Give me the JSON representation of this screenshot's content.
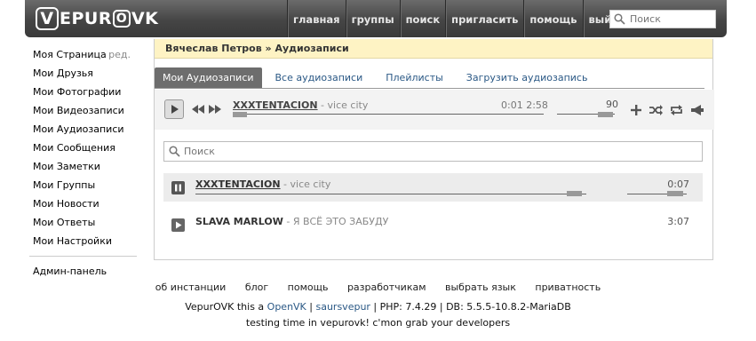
{
  "header": {
    "logo_text": "VEPUROVK",
    "logo_v": "V",
    "logo_epur": "EPUR",
    "logo_o": "O",
    "logo_vk": "VK",
    "nav": [
      "главная",
      "группы",
      "поиск",
      "пригласить",
      "помощь",
      "выйти"
    ],
    "search_placeholder": "Поиск"
  },
  "sidebar": {
    "items": [
      "Моя Страница",
      "Мои Друзья",
      "Мои Фотографии",
      "Мои Видеозаписи",
      "Мои Аудиозаписи",
      "Мои Сообщения",
      "Мои Заметки",
      "Мои Группы",
      "Мои Новости",
      "Мои Ответы",
      "Мои Настройки"
    ],
    "edit_label": "ред.",
    "admin": "Админ-панель"
  },
  "breadcrumb": {
    "user": "Вячеслав Петров",
    "sep": "»",
    "section": "Аудиозаписи"
  },
  "tabs": [
    "Мои Аудиозаписи",
    "Все аудиозаписи",
    "Плейлисты",
    "Загрузить аудиозапись"
  ],
  "player": {
    "artist": "XXXTENTACION",
    "dash": " - ",
    "title": "vice city",
    "time_current": "0:01",
    "time_total": "2:58",
    "volume": "90",
    "progress": 0.01,
    "volume_level": 0.9
  },
  "list": {
    "search_placeholder": "Поиск",
    "tracks": [
      {
        "artist": "XXXTENTACION",
        "title": "vice city",
        "duration": "0:07",
        "playing": true
      },
      {
        "artist": "SLAVA MARLOW",
        "title": "Я ВСЁ ЭТО ЗАБУДУ",
        "duration": "3:07",
        "playing": false
      }
    ]
  },
  "footer": {
    "links": [
      "об инстанции",
      "блог",
      "помощь",
      "разработчикам",
      "выбрать язык",
      "приватность"
    ],
    "line1_a": "VepurOVK this a ",
    "line1_link1": "OpenVK",
    "line1_sep": " | ",
    "line1_link2": "saursvepur",
    "line1_b": " | PHP: 7.4.29 | DB: 5.5.5-10.8.2-MariaDB",
    "line2": "testing time in vepurovk! c'mon grab your developers"
  },
  "colors": {
    "header_dark": "#3a3a3a",
    "crumb_bg": "#fef3c4",
    "link": "#2a5885",
    "active_tab": "#6d6d6d"
  }
}
